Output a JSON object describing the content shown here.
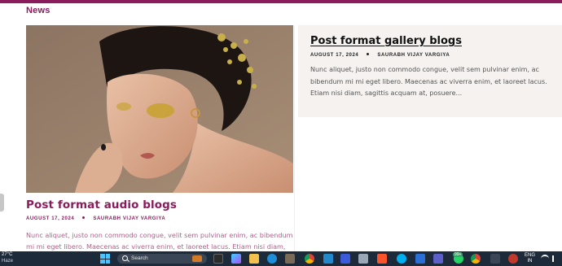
{
  "section": {
    "title": "News"
  },
  "posts": [
    {
      "title": "Post format audio blogs",
      "date": "AUGUST 17, 2024",
      "author": "SAURABH VIJAY VARGIYA",
      "excerpt": "Nunc aliquet, justo non commodo congue, velit sem pulvinar enim, ac bibendum mi mi eget libero. Maecenas ac viverra enim, et laoreet lacus. Etiam nisi diam, sagittis",
      "image_alt": "woman with gold glitter makeup and dried flowers in hair"
    },
    {
      "title": "Post format gallery blogs",
      "date": "AUGUST 17, 2024",
      "author": "SAURABH VIJAY VARGIYA",
      "excerpt": "Nunc aliquet, justo non commodo congue, velit sem pulvinar enim, ac bibendum mi mi eget libero. Maecenas ac viverra enim, et laoreet lacus. Etiam nisi diam, sagittis acquam at, posuere..."
    }
  ],
  "taskbar": {
    "weather_temp": "27°C",
    "weather_condition": "Haze",
    "search_label": "Search",
    "language": "ENG",
    "region": "IN",
    "notification_count": "99+",
    "apps": [
      "file-explorer-icon",
      "edge-icon",
      "chrome-icon",
      "vscode-icon",
      "brave-icon",
      "skype-icon",
      "teams-icon",
      "whatsapp-icon"
    ]
  },
  "colors": {
    "accent": "#8a1c5c",
    "taskbar": "#1c2a3a",
    "card_bg": "#f5f2f0"
  }
}
